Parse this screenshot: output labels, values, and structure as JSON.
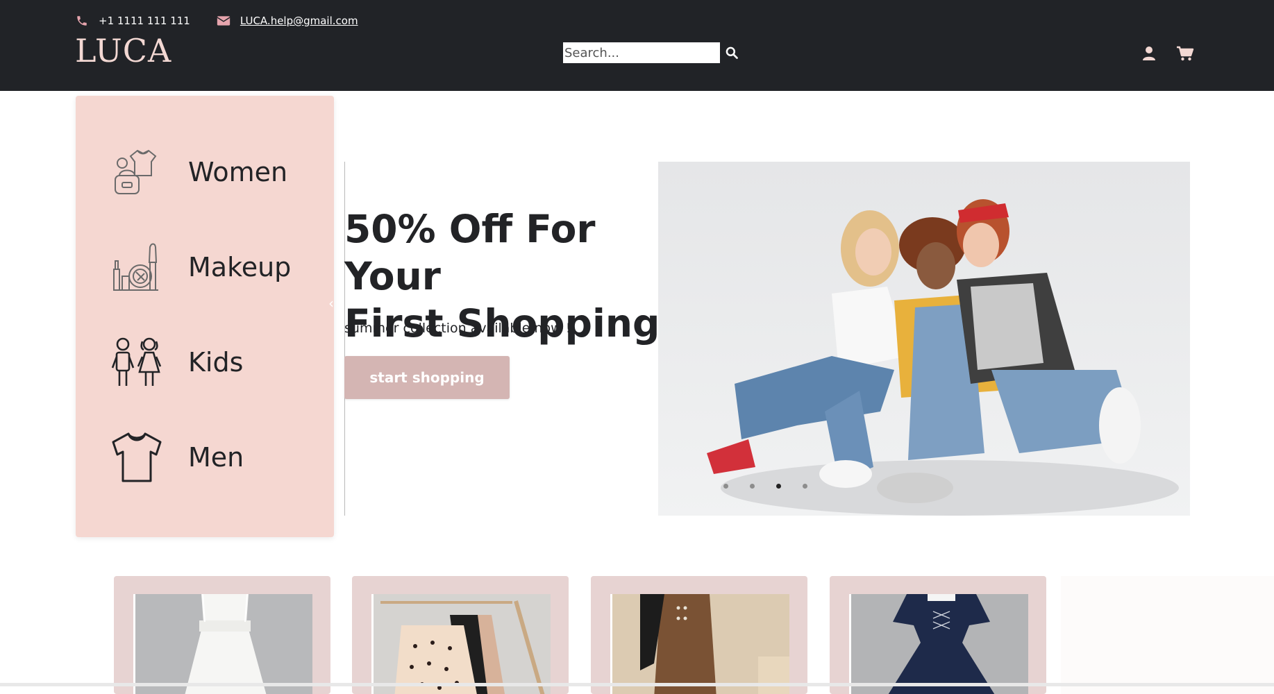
{
  "header": {
    "phone": "+1 1111 111 111",
    "email": "LUCA.help@gmail.com",
    "logo": "LUCA",
    "search_placeholder": "Search...",
    "icons": {
      "phone": "phone-icon",
      "email": "envelope-icon",
      "search": "search-icon",
      "user": "user-icon",
      "cart": "cart-icon"
    }
  },
  "categories": [
    {
      "label": "Women",
      "icon": "women-clothing-icon"
    },
    {
      "label": "Makeup",
      "icon": "makeup-icon"
    },
    {
      "label": "Kids",
      "icon": "kids-icon"
    },
    {
      "label": "Men",
      "icon": "tshirt-icon"
    }
  ],
  "hero": {
    "title_line1": "50% Off For Your",
    "title_line2": "First Shopping",
    "subtitle": "summer collection available now !",
    "cta": "start shopping",
    "slides_count": 4,
    "active_slide": 3
  },
  "products": [
    {
      "image": "white-dress"
    },
    {
      "image": "sweaters-on-rack"
    },
    {
      "image": "brown-trousers"
    },
    {
      "image": "navy-dress"
    }
  ],
  "colors": {
    "header_bg": "#212327",
    "accent_pink": "#f3d8d3",
    "icon_pink": "#e6a4ad",
    "panel_bg": "#f5d7d1",
    "button_bg": "#d4b5b3",
    "card_bg": "#e7d3d2"
  }
}
